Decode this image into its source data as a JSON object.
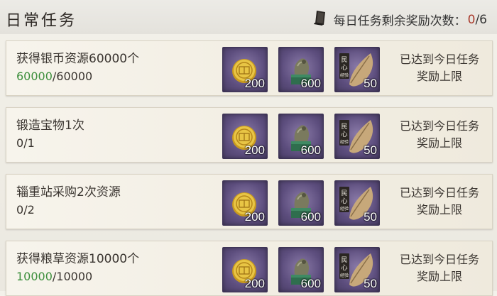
{
  "header": {
    "title": "日常任务",
    "counter_label": "每日任务剩余奖励次数：",
    "counter_current": "0",
    "counter_sep": "/",
    "counter_max": "6"
  },
  "tasks": [
    {
      "name": "获得银币资源60000个",
      "progress_current": "60000",
      "progress_sep": "/",
      "progress_total": "60000",
      "completed": true,
      "rewards": [
        {
          "icon": "experience-coin-icon",
          "qty": "200"
        },
        {
          "icon": "dragon-seal-icon",
          "qty": "600"
        },
        {
          "icon": "people-heart-leaf-icon",
          "qty": "50"
        }
      ],
      "status_line1": "已达到今日任务",
      "status_line2": "奖励上限"
    },
    {
      "name": "锻造宝物1次",
      "progress_current": "0",
      "progress_sep": "/",
      "progress_total": "1",
      "completed": false,
      "rewards": [
        {
          "icon": "experience-coin-icon",
          "qty": "200"
        },
        {
          "icon": "dragon-seal-icon",
          "qty": "600"
        },
        {
          "icon": "people-heart-leaf-icon",
          "qty": "50"
        }
      ],
      "status_line1": "已达到今日任务",
      "status_line2": "奖励上限"
    },
    {
      "name": "辎重站采购2次资源",
      "progress_current": "0",
      "progress_sep": "/",
      "progress_total": "2",
      "completed": false,
      "rewards": [
        {
          "icon": "experience-coin-icon",
          "qty": "200"
        },
        {
          "icon": "dragon-seal-icon",
          "qty": "600"
        },
        {
          "icon": "people-heart-leaf-icon",
          "qty": "50"
        }
      ],
      "status_line1": "已达到今日任务",
      "status_line2": "奖励上限"
    },
    {
      "name": "获得粮草资源10000个",
      "progress_current": "10000",
      "progress_sep": "/",
      "progress_total": "10000",
      "completed": true,
      "rewards": [
        {
          "icon": "experience-coin-icon",
          "qty": "200"
        },
        {
          "icon": "dragon-seal-icon",
          "qty": "600"
        },
        {
          "icon": "people-heart-leaf-icon",
          "qty": "50"
        }
      ],
      "status_line1": "已达到今日任务",
      "status_line2": "奖励上限"
    }
  ],
  "colors": {
    "progress_done": "#3d8f3d",
    "counter_value": "#a93a2c",
    "reward_bg": "#5d4e7e"
  }
}
